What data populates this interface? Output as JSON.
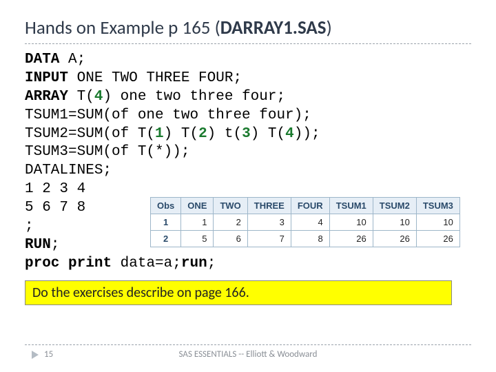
{
  "title": {
    "part1": "Hands on Example p 165 (",
    "part2_bold": "DARRAY1.SAS",
    "part3": ")"
  },
  "code": {
    "l1a": "DATA",
    "l1b": " A;",
    "l2a": "INPUT",
    "l2b": " ONE TWO THREE FOUR;",
    "l3a": "ARRAY",
    "l3b": " T(",
    "l3n": "4",
    "l3c": ") one two three four;",
    "l4": "TSUM1=SUM(of one two three four);",
    "l5a": "TSUM2=SUM(of T(",
    "l5n1": "1",
    "l5b": ") T(",
    "l5n2": "2",
    "l5c": ") t(",
    "l5n3": "3",
    "l5d": ") T(",
    "l5n4": "4",
    "l5e": "));",
    "l6": "TSUM3=SUM(of T(*));",
    "l7": "DATALINES;",
    "l8": "1 2 3 4",
    "l9": "5 6 7 8",
    "l10": ";",
    "l11a": "RUN",
    "l11b": ";",
    "l12a": "proc",
    "l12sp1": " ",
    "l12b": "print",
    "l12c": " data=a;",
    "l12d": "run",
    "l12e": ";"
  },
  "table": {
    "headers": [
      "Obs",
      "ONE",
      "TWO",
      "THREE",
      "FOUR",
      "TSUM1",
      "TSUM2",
      "TSUM3"
    ],
    "rows": [
      {
        "obs": "1",
        "one": "1",
        "two": "2",
        "three": "3",
        "four": "4",
        "t1": "10",
        "t2": "10",
        "t3": "10"
      },
      {
        "obs": "2",
        "one": "5",
        "two": "6",
        "three": "7",
        "four": "8",
        "t1": "26",
        "t2": "26",
        "t3": "26"
      }
    ]
  },
  "callout": "Do the exercises describe on page 166.",
  "footer": {
    "page": "15",
    "source": "SAS ESSENTIALS -- Elliott & Woodward"
  }
}
